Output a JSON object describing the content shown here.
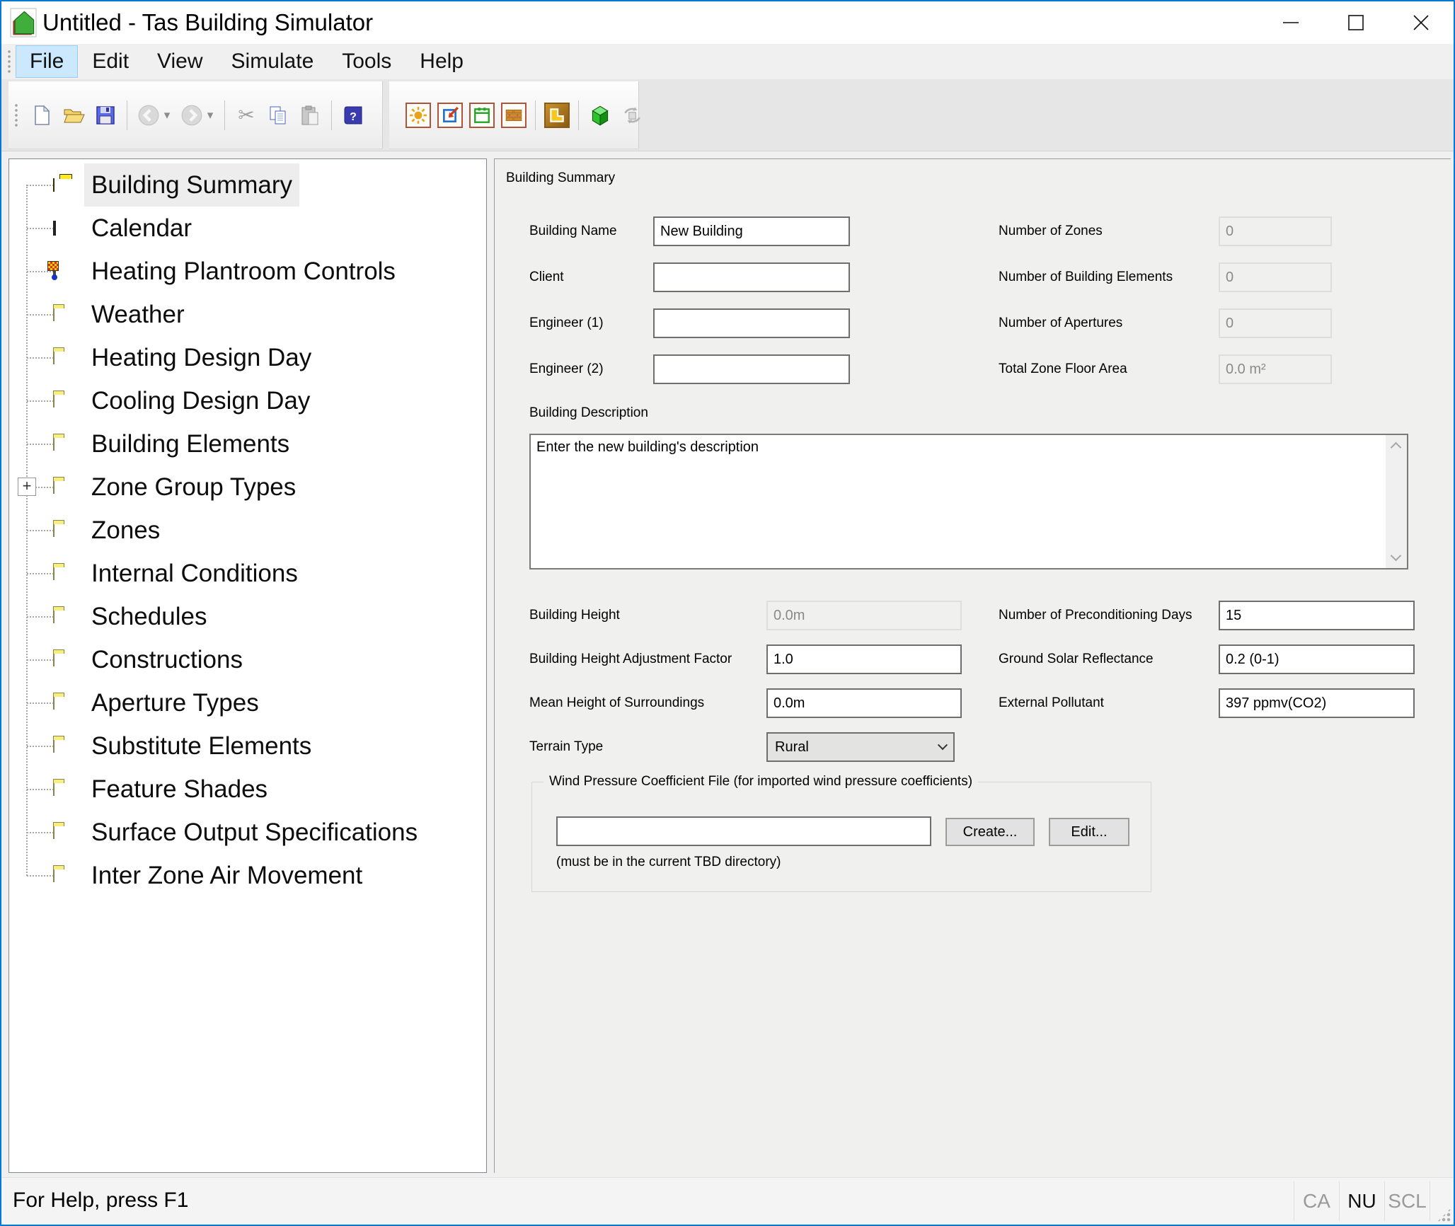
{
  "window": {
    "title": "Untitled - Tas Building Simulator"
  },
  "menu": {
    "items": [
      "File",
      "Edit",
      "View",
      "Simulate",
      "Tools",
      "Help"
    ]
  },
  "toolbar": {
    "group1_icons": [
      "new-document",
      "open-file",
      "save-file",
      "back",
      "forward",
      "cut",
      "copy",
      "paste",
      "help"
    ],
    "group2_icons": [
      "weather",
      "internal-conditions",
      "calendar",
      "constructions",
      "zones",
      "3d-view",
      "simulate"
    ]
  },
  "tree": {
    "items": [
      {
        "label": "Building Summary",
        "icon": "building-summary",
        "selected": true
      },
      {
        "label": "Calendar",
        "icon": "calendar"
      },
      {
        "label": "Heating Plantroom Controls",
        "icon": "plantroom"
      },
      {
        "label": "Weather",
        "icon": "folder"
      },
      {
        "label": "Heating Design Day",
        "icon": "folder"
      },
      {
        "label": "Cooling Design Day",
        "icon": "folder"
      },
      {
        "label": "Building Elements",
        "icon": "folder"
      },
      {
        "label": "Zone Group Types",
        "icon": "folder",
        "expandable": true
      },
      {
        "label": "Zones",
        "icon": "folder"
      },
      {
        "label": "Internal Conditions",
        "icon": "folder"
      },
      {
        "label": "Schedules",
        "icon": "folder"
      },
      {
        "label": "Constructions",
        "icon": "folder"
      },
      {
        "label": "Aperture Types",
        "icon": "folder"
      },
      {
        "label": "Substitute Elements",
        "icon": "folder"
      },
      {
        "label": "Feature Shades",
        "icon": "folder"
      },
      {
        "label": "Surface Output Specifications",
        "icon": "folder"
      },
      {
        "label": "Inter Zone Air Movement",
        "icon": "folder"
      }
    ],
    "expander_glyph": "+"
  },
  "form": {
    "title": "Building Summary",
    "building_name": {
      "label": "Building Name",
      "value": "New Building"
    },
    "client": {
      "label": "Client",
      "value": ""
    },
    "engineer1": {
      "label": "Engineer (1)",
      "value": ""
    },
    "engineer2": {
      "label": "Engineer (2)",
      "value": ""
    },
    "num_zones": {
      "label": "Number of Zones",
      "value": "0"
    },
    "num_building_elements": {
      "label": "Number of Building Elements",
      "value": "0"
    },
    "num_apertures": {
      "label": "Number of Apertures",
      "value": "0"
    },
    "total_zone_floor_area": {
      "label": "Total Zone Floor Area",
      "value": "0.0 m²"
    },
    "building_description": {
      "label": "Building Description",
      "value": "Enter the new building's description"
    },
    "building_height": {
      "label": "Building Height",
      "value": "0.0m"
    },
    "building_height_adjustment_factor": {
      "label": "Building Height Adjustment Factor",
      "value": "1.0"
    },
    "mean_height_of_surroundings": {
      "label": "Mean Height of Surroundings",
      "value": "0.0m"
    },
    "terrain_type": {
      "label": "Terrain Type",
      "value": "Rural"
    },
    "preconditioning_days": {
      "label": "Number of Preconditioning Days",
      "value": "15"
    },
    "ground_solar_reflectance": {
      "label": "Ground Solar Reflectance",
      "value": "0.2 (0-1)"
    },
    "external_pollutant": {
      "label": "External Pollutant",
      "value": "397 ppmv(CO2)"
    },
    "wind_pressure": {
      "title": "Wind Pressure Coefficient File (for imported wind pressure coefficients)",
      "file_value": "",
      "create_label": "Create...",
      "edit_label": "Edit...",
      "note": "(must be in the current TBD directory)"
    }
  },
  "statusbar": {
    "message": "For Help, press F1",
    "indicators": [
      "CA",
      "NU",
      "SCL"
    ]
  },
  "colors": {
    "window_border": "#0079d7",
    "menu_highlight": "#cce8ff",
    "selection_bg": "#ededed",
    "form_bg": "#f0f0ee"
  }
}
